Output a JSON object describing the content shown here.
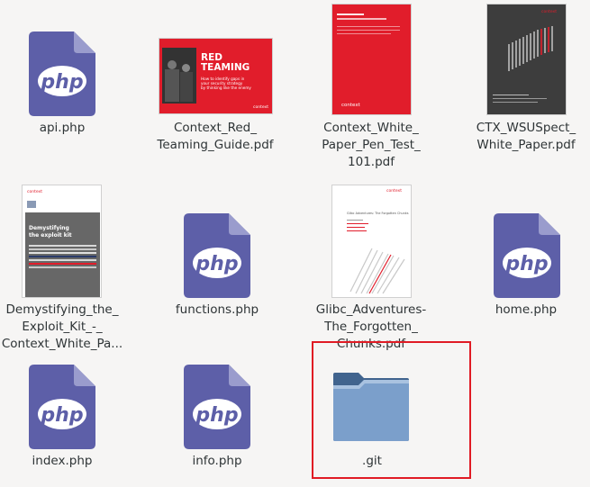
{
  "files": [
    {
      "name": "api.php",
      "type": "php"
    },
    {
      "name": "Context_Red_\nTeaming_Guide.pdf",
      "type": "pdf"
    },
    {
      "name": "Context_White_\nPaper_Pen_Test_\n101.pdf",
      "type": "pdf"
    },
    {
      "name": "CTX_WSUSpect_\nWhite_Paper.pdf",
      "type": "pdf"
    },
    {
      "name": "Demystifying_the_\nExploit_Kit_-_\nContext_White_Pa...",
      "type": "pdf"
    },
    {
      "name": "functions.php",
      "type": "php"
    },
    {
      "name": "Glibc_Adventures-\nThe_Forgotten_\nChunks.pdf",
      "type": "pdf"
    },
    {
      "name": "home.php",
      "type": "php"
    },
    {
      "name": "index.php",
      "type": "php"
    },
    {
      "name": "info.php",
      "type": "php"
    },
    {
      "name": ".git",
      "type": "folder"
    }
  ],
  "icon_text": {
    "php": "php",
    "red_teaming_title": "RED\nTEAMING",
    "red_teaming_sub": "How to identify gaps in\nyour security strategy\nby thinking like the enemy",
    "context_brand": "context",
    "exploit_kit_title": "Demystifying\nthe exploit kit",
    "glibc_title": "Glibc Adventures: The Forgotten Chunks"
  },
  "colors": {
    "background": "#f6f5f4",
    "php_icon": "#5d5fa8",
    "php_fold": "#9a9ccd",
    "context_red": "#e11d2b",
    "highlight": "#e01b24",
    "folder": "#6d95c2"
  },
  "selected_item": ".git"
}
